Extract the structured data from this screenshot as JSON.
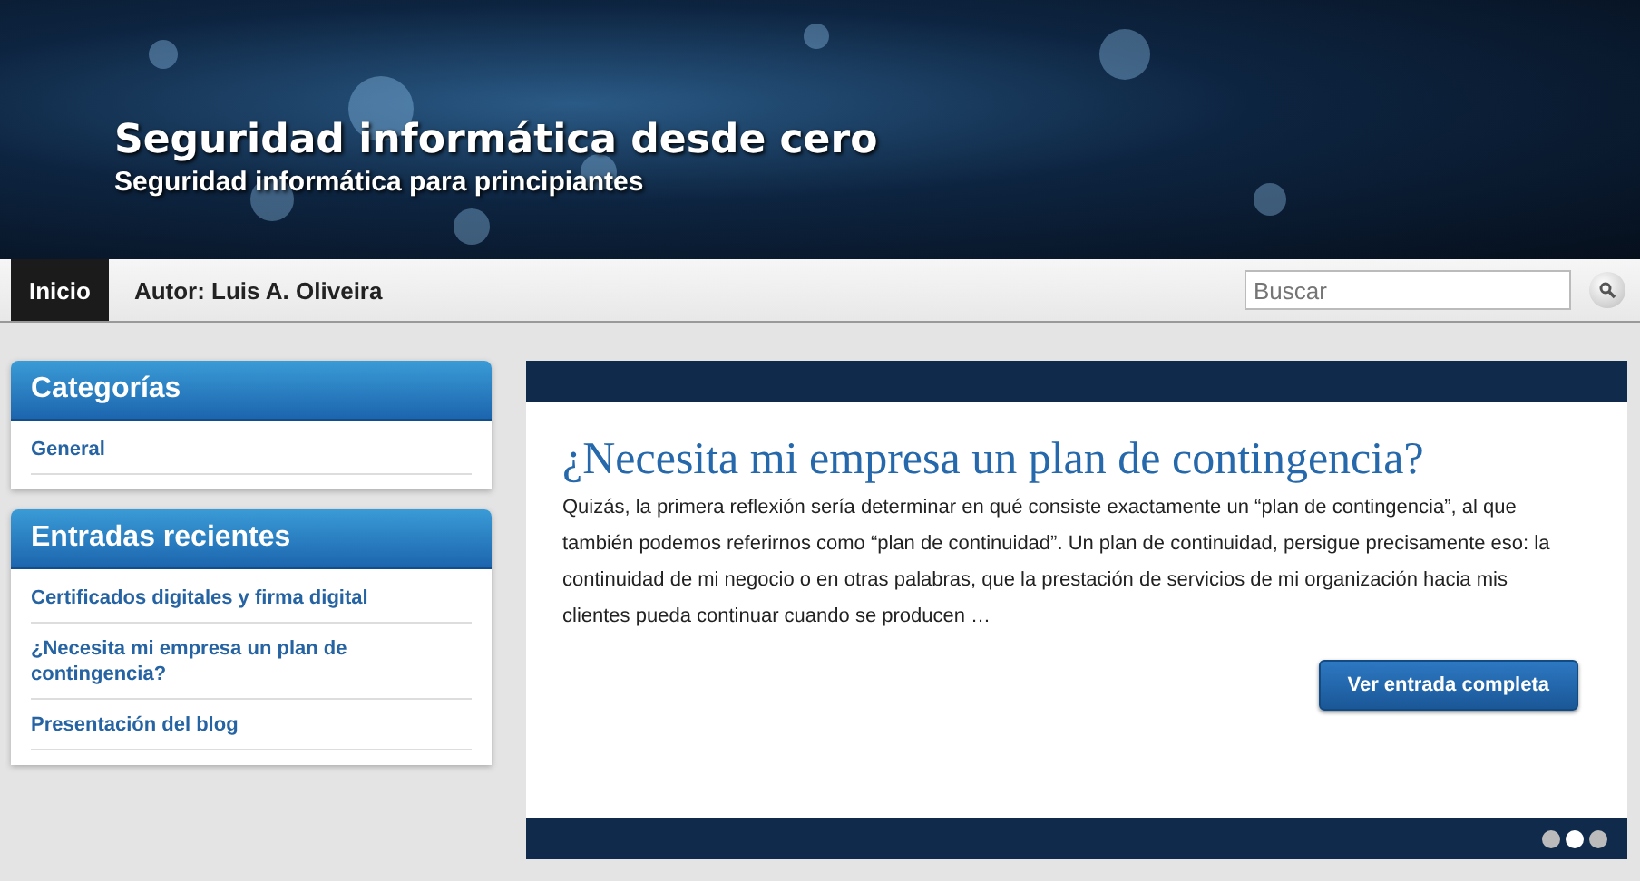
{
  "header": {
    "title": "Seguridad informática desde cero",
    "subtitle": "Seguridad informática para principiantes"
  },
  "nav": {
    "items": [
      {
        "label": "Inicio",
        "selected": true
      },
      {
        "label": "Autor: Luis A. Oliveira",
        "selected": false
      }
    ],
    "search": {
      "placeholder": "Buscar"
    }
  },
  "sidebar": [
    {
      "title": "Categorías",
      "links": [
        "General"
      ]
    },
    {
      "title": "Entradas recientes",
      "links": [
        "Certificados digitales y firma digital",
        "¿Necesita mi empresa un plan de contingencia?",
        "Presentación del blog"
      ]
    }
  ],
  "slide": {
    "title": "¿Necesita mi empresa un plan de contingencia?",
    "excerpt": "Quizás, la primera reflexión sería determinar en qué consiste exactamente un “plan de contingencia”, al que también podemos referirnos como “plan de continuidad”. Un plan de continuidad, persigue precisamente eso: la continuidad de mi negocio o en otras palabras, que la prestación de servicios de mi organización hacia mis clientes pueda continuar cuando se producen …",
    "button": "Ver entrada completa",
    "dots": [
      {
        "selected": false
      },
      {
        "selected": true
      },
      {
        "selected": false
      }
    ]
  }
}
